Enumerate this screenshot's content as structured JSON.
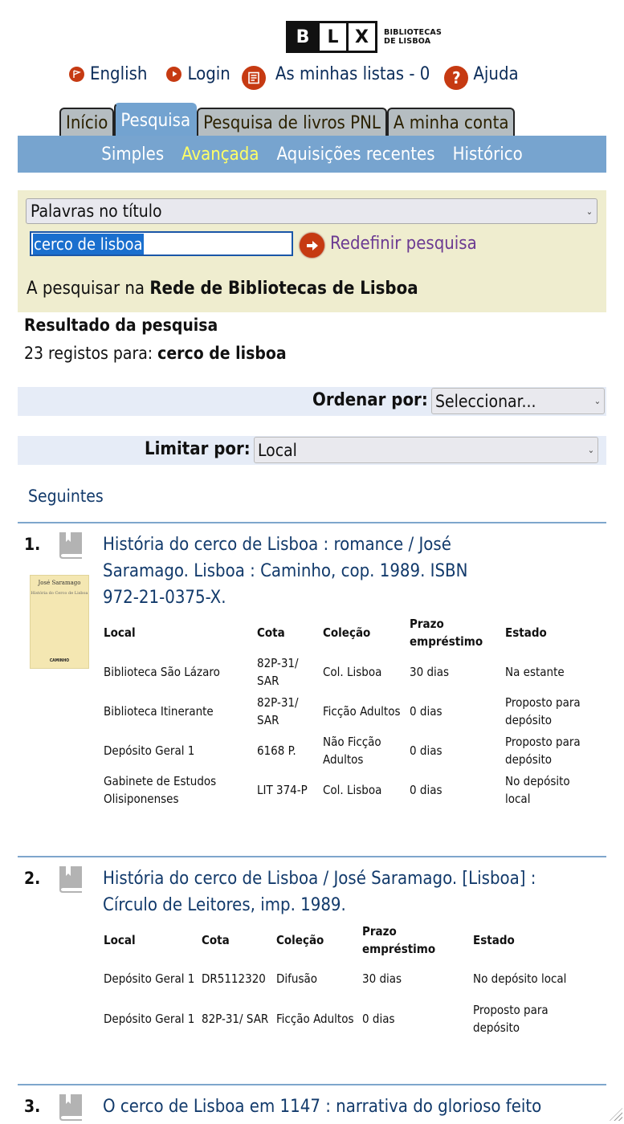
{
  "logo": {
    "letters": [
      "B",
      "L",
      "X"
    ],
    "line1": "BIBLIOTECAS",
    "line2": "DE LISBOA"
  },
  "toplinks": [
    {
      "label": "English",
      "icon": "flag-icon"
    },
    {
      "label": "Login",
      "icon": "play-icon"
    },
    {
      "label": "As minhas listas - 0",
      "icon": "list-icon"
    },
    {
      "label": "Ajuda",
      "icon": "help-icon"
    }
  ],
  "tabs": [
    {
      "label": "Início",
      "active": false
    },
    {
      "label": "Pesquisa",
      "active": true
    },
    {
      "label": "Pesquisa de livros PNL",
      "active": false
    },
    {
      "label": "A minha conta",
      "active": false
    }
  ],
  "subnav": [
    {
      "label": "Simples",
      "selected": false
    },
    {
      "label": "Avançada",
      "selected": true
    },
    {
      "label": "Aquisições recentes",
      "selected": false
    },
    {
      "label": "Histórico",
      "selected": false
    }
  ],
  "search": {
    "field": "Palavras no título",
    "query": "cerco de lisboa",
    "reset_label": "Redefinir pesquisa",
    "scope_prefix": "A pesquisar na ",
    "scope_name": "Rede de Bibliotecas de Lisboa"
  },
  "results": {
    "heading": "Resultado da pesquisa",
    "count": "23",
    "count_text": " registos para: ",
    "query": "cerco de lisboa",
    "sort_label": "Ordenar por:",
    "sort_value": "Seleccionar...",
    "limit_label": "Limitar por:",
    "limit_value": "Local",
    "next_label": "Seguintes"
  },
  "colors": {
    "accent": "#77a4cf",
    "icon_red": "#c63a12",
    "link": "#123a6b",
    "subnav_selected": "#ffff66"
  },
  "records": [
    {
      "num": "1.",
      "title_lines": [
        "História do cerco de Lisboa : romance / José",
        "Saramago. Lisboa : Caminho, cop. 1989. ISBN",
        "972-21-0375-X."
      ],
      "cover": {
        "author": "José Saramago",
        "title": "História do Cerco de Lisboa",
        "publisher": "CAMINHO"
      },
      "headers": [
        "Local",
        "Cota",
        "Coleção",
        "Prazo empréstimo",
        "Estado"
      ],
      "rows": [
        [
          "Biblioteca São Lázaro",
          "82P-31/ SAR",
          "Col. Lisboa",
          "30 dias",
          "Na estante"
        ],
        [
          "Biblioteca Itinerante",
          "82P-31/ SAR",
          "Ficção Adultos",
          "0 dias",
          "Proposto para depósito"
        ],
        [
          "Depósito Geral 1",
          "6168 P.",
          "Não Ficção Adultos",
          "0 dias",
          "Proposto para depósito"
        ],
        [
          "Gabinete de Estudos Olisiponenses",
          "LIT 374-P",
          "Col. Lisboa",
          "0 dias",
          "No depósito local"
        ]
      ]
    },
    {
      "num": "2.",
      "title_lines": [
        "História do cerco de Lisboa / José Saramago. [Lisboa] :",
        "Círculo de Leitores, imp. 1989."
      ],
      "headers": [
        "Local",
        "Cota",
        "Coleção",
        "Prazo empréstimo",
        "Estado"
      ],
      "rows": [
        [
          "Depósito Geral 1",
          "DR5112320",
          "Difusão",
          "30 dias",
          "No depósito local"
        ],
        [
          "Depósito Geral 1",
          "82P-31/ SAR",
          "Ficção Adultos",
          "0 dias",
          "Proposto para depósito"
        ]
      ]
    },
    {
      "num": "3.",
      "title_lines": [
        "O cerco de Lisboa em 1147 : narrativa do glorioso feito"
      ]
    }
  ]
}
